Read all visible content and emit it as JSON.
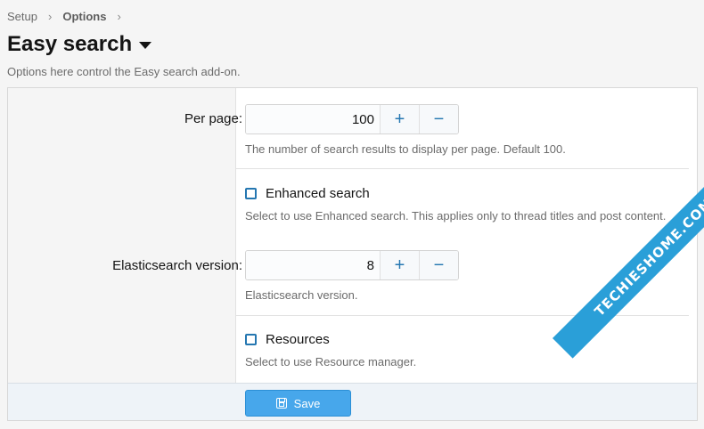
{
  "breadcrumb": {
    "items": [
      "Setup",
      "Options"
    ]
  },
  "page": {
    "title": "Easy search",
    "description": "Options here control the Easy search add-on."
  },
  "options": {
    "per_page": {
      "label": "Per page:",
      "value": "100",
      "hint": "The number of search results to display per page. Default 100."
    },
    "enhanced_search": {
      "label": "Enhanced search",
      "checked": false,
      "hint": "Select to use Enhanced search. This applies only to thread titles and post content."
    },
    "elasticsearch_version": {
      "label": "Elasticsearch version:",
      "value": "8",
      "hint": "Elasticsearch version."
    },
    "resources": {
      "label": "Resources",
      "checked": false,
      "hint": "Select to use Resource manager."
    }
  },
  "buttons": {
    "increment_glyph": "+",
    "decrement_glyph": "−"
  },
  "footer": {
    "save_label": "Save"
  },
  "watermark": {
    "text": "TECHIESHOME.COM"
  },
  "colors": {
    "accent": "#2577b1",
    "save_button": "#47a7eb",
    "watermark": "#2a9fd8"
  }
}
